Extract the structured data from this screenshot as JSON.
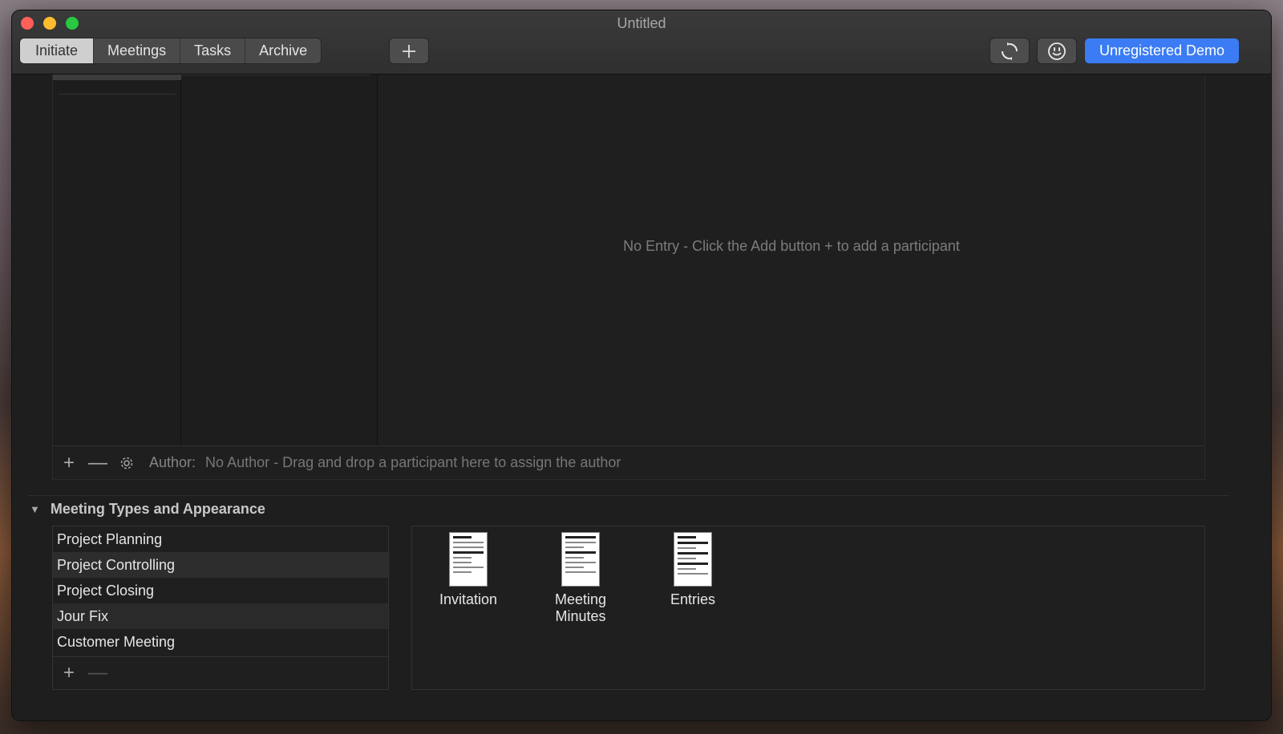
{
  "window": {
    "title": "Untitled"
  },
  "toolbar": {
    "tabs": [
      {
        "label": "Initiate",
        "active": true
      },
      {
        "label": "Meetings",
        "active": false
      },
      {
        "label": "Tasks",
        "active": false
      },
      {
        "label": "Archive",
        "active": false
      }
    ],
    "add_icon": "plus-icon",
    "sync_icon": "sync-icon",
    "feedback_icon": "smiley-icon",
    "demo_label": "Unregistered Demo",
    "accent_color": "#3b7cf5"
  },
  "participants": {
    "empty_message": "No Entry - Click the Add button + to add a participant",
    "add_label": "+",
    "remove_label": "—",
    "author_label": "Author:",
    "author_value": "No Author - Drag and drop a participant here to assign the author"
  },
  "meeting_types": {
    "section_title": "Meeting Types and Appearance",
    "disclosure_glyph": "▼",
    "items": [
      "Project Planning",
      "Project Controlling",
      "Project Closing",
      "Jour Fix",
      "Customer Meeting"
    ],
    "add_label": "+",
    "remove_label": "—"
  },
  "documents": [
    {
      "label": "Invitation"
    },
    {
      "label": "Meeting Minutes"
    },
    {
      "label": "Entries"
    }
  ]
}
